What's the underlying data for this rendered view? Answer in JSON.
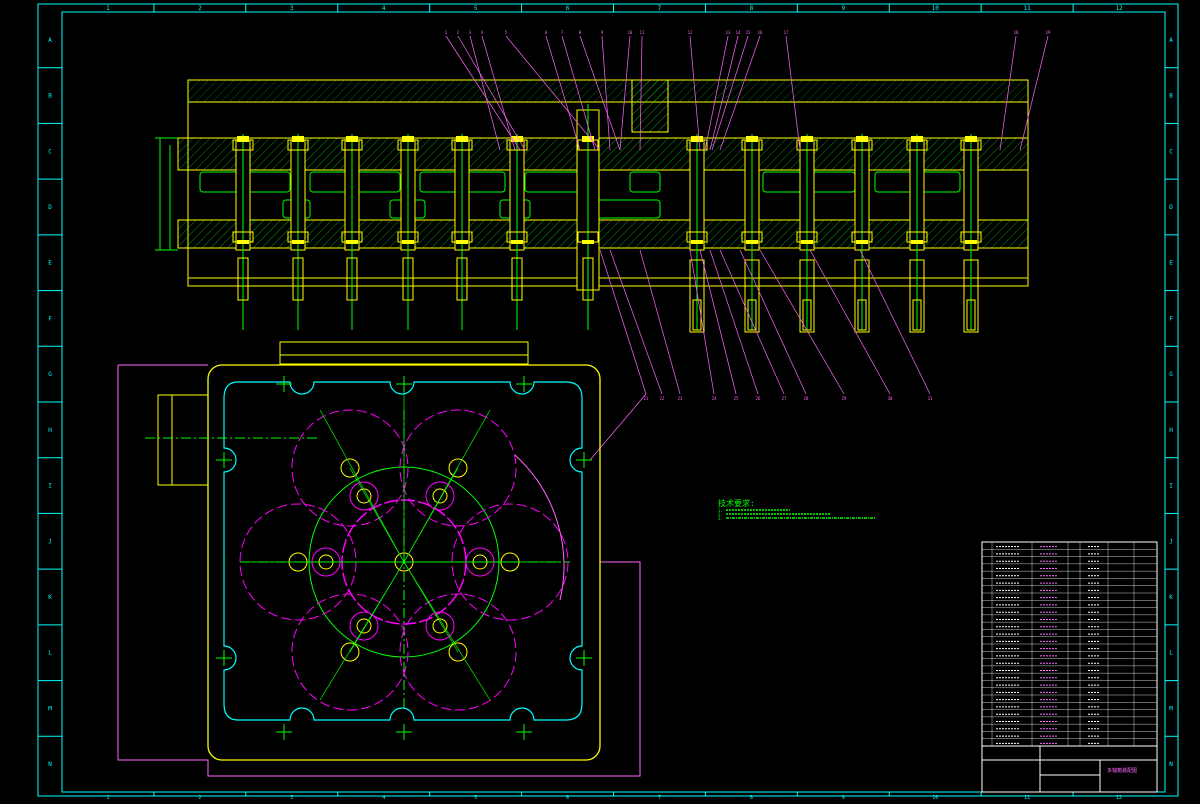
{
  "sheet": {
    "column_labels": [
      "1",
      "2",
      "3",
      "4",
      "5",
      "6",
      "7",
      "8",
      "9",
      "10",
      "11",
      "12"
    ],
    "row_labels": [
      "A",
      "B",
      "C",
      "D",
      "E",
      "F",
      "G",
      "H",
      "I",
      "J",
      "K",
      "L",
      "M",
      "N"
    ]
  },
  "colors": {
    "frame": "#00ffff",
    "outline": "#ffff00",
    "part": "#00ff00",
    "hatch": "#00ff00",
    "leader": "#ff66ff",
    "hidden": "#ff00ff",
    "text": "#ffffff",
    "notes": "#00ff00"
  },
  "callouts_top": [
    "1",
    "2",
    "3",
    "4",
    "5",
    "6",
    "7",
    "8",
    "9",
    "10",
    "11",
    "12",
    "13",
    "14",
    "15",
    "16",
    "17",
    "18",
    "19",
    "20"
  ],
  "callouts_bottom": [
    "21",
    "22",
    "23",
    "24",
    "25",
    "26",
    "27",
    "28",
    "29",
    "30",
    "31",
    "32"
  ],
  "technical_notes": {
    "title": "技术要求:",
    "lines": [
      "1.",
      "2.",
      "3."
    ]
  },
  "title_block": {
    "drawing_title": "多轴箱装配图"
  }
}
